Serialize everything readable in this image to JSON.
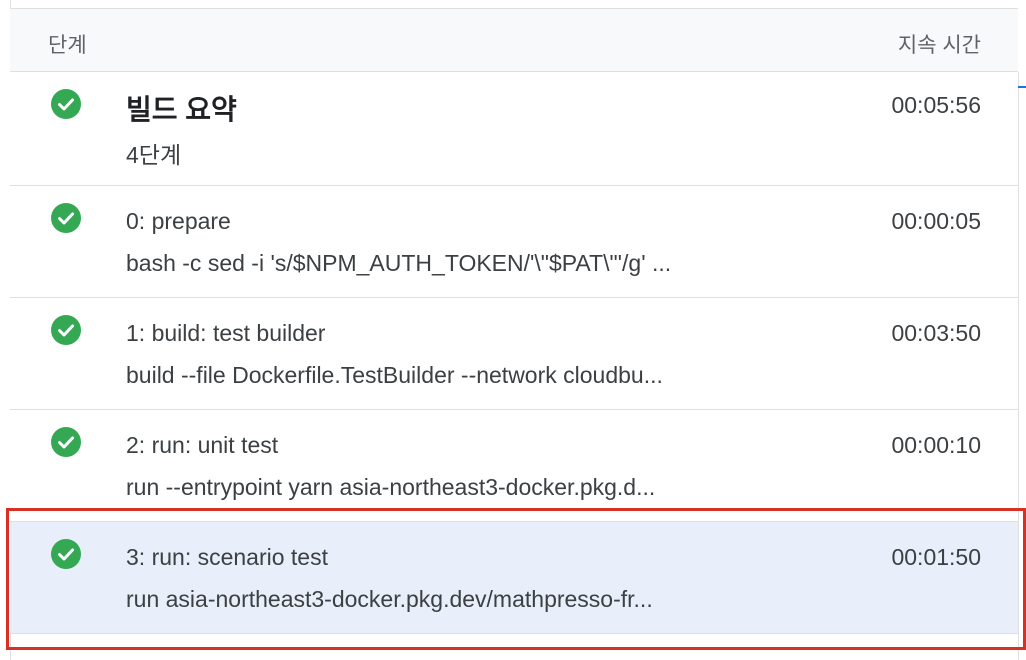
{
  "table": {
    "header": {
      "step": "단계",
      "duration": "지속 시간"
    },
    "summary": {
      "title": "빌드 요약",
      "subtitle": "4단계",
      "duration": "00:05:56",
      "status": "success"
    },
    "steps": [
      {
        "title": "0: prepare",
        "subtitle": "bash -c sed -i 's/$NPM_AUTH_TOKEN/'\\\"$PAT\\\"'/g' ...",
        "duration": "00:00:05",
        "status": "success"
      },
      {
        "title": "1: build: test builder",
        "subtitle": "build --file Dockerfile.TestBuilder --network cloudbu...",
        "duration": "00:03:50",
        "status": "success"
      },
      {
        "title": "2: run: unit test",
        "subtitle": "run --entrypoint yarn asia-northeast3-docker.pkg.d...",
        "duration": "00:00:10",
        "status": "success"
      },
      {
        "title": "3: run: scenario test",
        "subtitle": "run asia-northeast3-docker.pkg.dev/mathpresso-fr...",
        "duration": "00:01:50",
        "status": "success",
        "selected": true
      }
    ]
  },
  "colors": {
    "success": "#34a853",
    "selected_bg": "#e8eefa",
    "highlight": "#d93025",
    "accent": "#1a73e8"
  },
  "icons": {
    "status": "check-circle-icon"
  }
}
